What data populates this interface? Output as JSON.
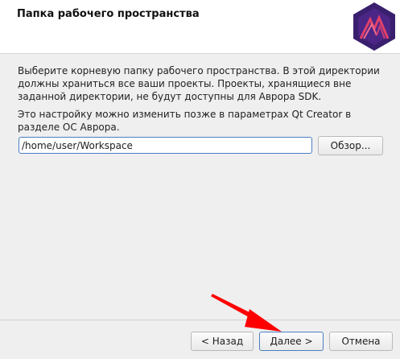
{
  "header": {
    "title": "Папка рабочего пространства",
    "logo_icon": "aurora-logo-icon"
  },
  "main": {
    "description": "Выберите корневую папку рабочего пространства. В этой директории должны храниться все ваши проекты. Проекты, хранящиеся вне заданной директории, не будут доступны для Аврора SDK.",
    "note": "Это настройку можно изменить позже в параметрах Qt Creator в разделе ОС Аврора.",
    "path_value": "/home/user/Workspace",
    "browse_label": "Обзор..."
  },
  "footer": {
    "back_label": "< Назад",
    "next_label": "Далее >",
    "cancel_label": "Отмена"
  },
  "colors": {
    "accent": "#4a7fc4",
    "arrow": "#ff0000",
    "logo_bg": "#3a1f6e"
  }
}
